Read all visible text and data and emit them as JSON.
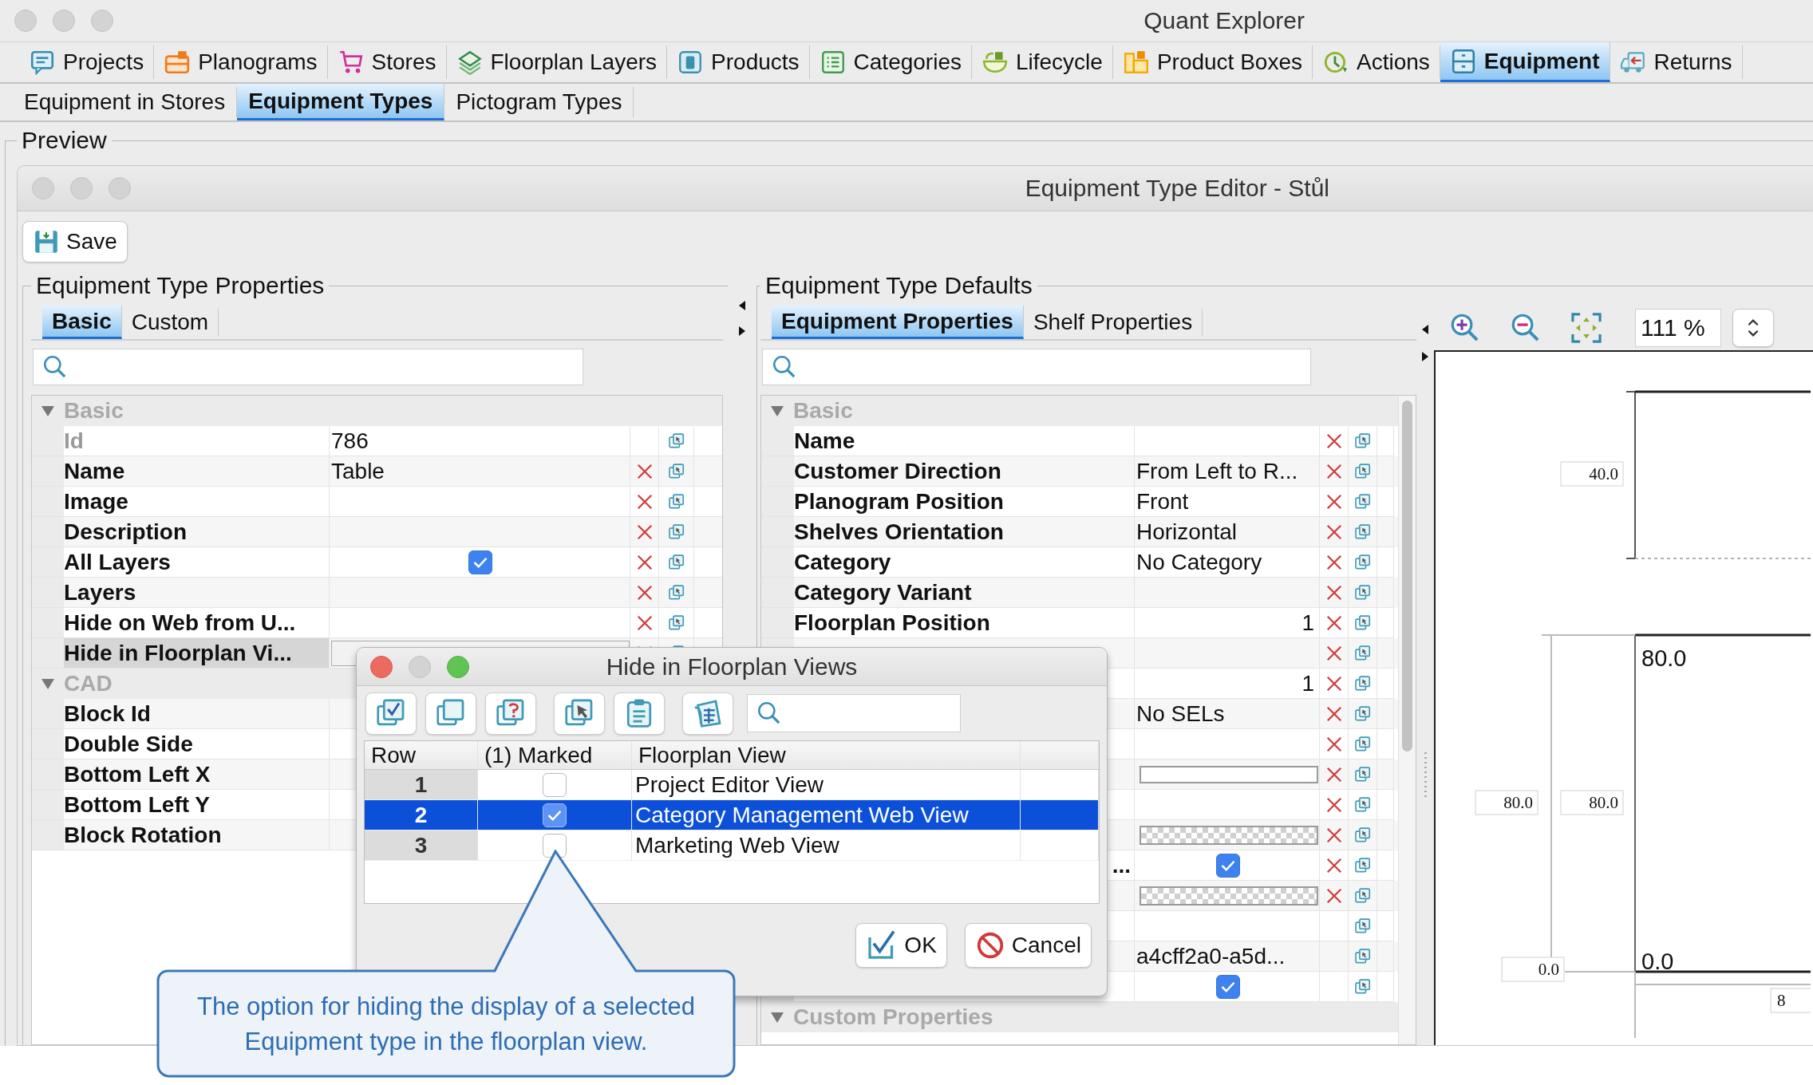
{
  "window": {
    "title": "Quant Explorer"
  },
  "main_tabs": [
    {
      "label": "Projects",
      "selected": false
    },
    {
      "label": "Planograms",
      "selected": false
    },
    {
      "label": "Stores",
      "selected": false
    },
    {
      "label": "Floorplan Layers",
      "selected": false
    },
    {
      "label": "Products",
      "selected": false
    },
    {
      "label": "Categories",
      "selected": false
    },
    {
      "label": "Lifecycle",
      "selected": false
    },
    {
      "label": "Product Boxes",
      "selected": false
    },
    {
      "label": "Actions",
      "selected": false
    },
    {
      "label": "Equipment",
      "selected": true
    },
    {
      "label": "Returns",
      "selected": false
    }
  ],
  "sub_tabs": [
    {
      "label": "Equipment in Stores",
      "selected": false
    },
    {
      "label": "Equipment Types",
      "selected": true
    },
    {
      "label": "Pictogram Types",
      "selected": false
    }
  ],
  "preview": {
    "label": "Preview"
  },
  "editor": {
    "title": "Equipment Type Editor - Stůl",
    "save_button": "Save"
  },
  "properties": {
    "title": "Equipment Type Properties",
    "tabs": [
      {
        "label": "Basic",
        "selected": true
      },
      {
        "label": "Custom",
        "selected": false
      }
    ],
    "rows": [
      {
        "kind": "group",
        "name": "Basic",
        "expanded": true
      },
      {
        "kind": "text",
        "name": "Id",
        "value": "786",
        "disabled": true,
        "selected": false,
        "removable": false,
        "copyable": true
      },
      {
        "kind": "text",
        "name": "Name",
        "value": "Table",
        "disabled": false,
        "selected": false,
        "removable": true,
        "copyable": true
      },
      {
        "kind": "text",
        "name": "Image",
        "disabled": false,
        "selected": false,
        "removable": true,
        "copyable": true
      },
      {
        "kind": "text",
        "name": "Description",
        "disabled": false,
        "selected": false,
        "removable": true,
        "copyable": true
      },
      {
        "kind": "check",
        "name": "All Layers",
        "checked": true,
        "disabled": false,
        "selected": false,
        "removable": true,
        "copyable": true
      },
      {
        "kind": "text",
        "name": "Layers",
        "disabled": false,
        "selected": false,
        "removable": true,
        "copyable": true
      },
      {
        "kind": "text",
        "name": "Hide on Web from U...",
        "disabled": false,
        "selected": false,
        "removable": true,
        "copyable": true
      },
      {
        "kind": "field",
        "name": "Hide in Floorplan Vi...",
        "disabled": false,
        "selected": true,
        "removable": true,
        "copyable": true
      },
      {
        "kind": "group",
        "name": "CAD",
        "expanded": true
      },
      {
        "kind": "text",
        "name": "Block Id",
        "disabled": false,
        "selected": false
      },
      {
        "kind": "text",
        "name": "Double Side",
        "disabled": false,
        "selected": false
      },
      {
        "kind": "text",
        "name": "Bottom Left X",
        "disabled": false,
        "selected": false
      },
      {
        "kind": "text",
        "name": "Bottom Left Y",
        "disabled": false,
        "selected": false
      },
      {
        "kind": "text",
        "name": "Block Rotation",
        "disabled": false,
        "selected": false
      }
    ]
  },
  "defaults": {
    "title": "Equipment Type Defaults",
    "tabs": [
      {
        "label": "Equipment Properties",
        "selected": true
      },
      {
        "label": "Shelf Properties",
        "selected": false
      }
    ],
    "rows": [
      {
        "kind": "group",
        "name": "Basic",
        "expanded": true
      },
      {
        "kind": "text",
        "name": "Name",
        "removable": true,
        "copyable": true
      },
      {
        "kind": "text",
        "name": "Customer Direction",
        "value": "From Left to R...",
        "removable": true,
        "copyable": true
      },
      {
        "kind": "text",
        "name": "Planogram Position",
        "value": "Front",
        "removable": true,
        "copyable": true
      },
      {
        "kind": "text",
        "name": "Shelves Orientation",
        "value": "Horizontal",
        "removable": true,
        "copyable": true
      },
      {
        "kind": "text",
        "name": "Category",
        "value": "No Category",
        "removable": true,
        "copyable": true
      },
      {
        "kind": "text",
        "name": "Category Variant",
        "removable": true,
        "copyable": true
      },
      {
        "kind": "number",
        "name": "Floorplan Position",
        "value": "1",
        "removable": true,
        "copyable": true
      },
      {
        "kind": "text",
        "removable": true,
        "copyable": true
      },
      {
        "kind": "number",
        "value": "1",
        "removable": true,
        "copyable": true
      },
      {
        "kind": "text",
        "value": "No SELs",
        "removable": true,
        "copyable": true
      },
      {
        "kind": "text",
        "removable": true,
        "copyable": true
      },
      {
        "kind": "bar",
        "removable": true,
        "copyable": true
      },
      {
        "kind": "text",
        "removable": true,
        "copyable": true
      },
      {
        "kind": "pattern",
        "removable": true,
        "copyable": true
      },
      {
        "kind": "check",
        "name": "...",
        "name_cut": true,
        "checked": true,
        "removable": true,
        "copyable": true
      },
      {
        "kind": "pattern",
        "removable": true,
        "copyable": true
      },
      {
        "kind": "text",
        "removable": false,
        "copyable": true
      },
      {
        "kind": "text",
        "value": "a4cff2a0-a5d...",
        "removable": false,
        "copyable": true
      },
      {
        "kind": "check",
        "checked": true,
        "removable": false,
        "copyable": true
      },
      {
        "kind": "group",
        "name": "Custom Properties",
        "expanded": true
      }
    ]
  },
  "preview_canvas": {
    "zoom": "111 %",
    "dimension_labels": [
      "40.0",
      "80.0",
      "80.0",
      "0.0",
      "8"
    ],
    "corner_labels": [
      "80.0",
      "0.0"
    ]
  },
  "dialog": {
    "title": "Hide in Floorplan Views",
    "columns": [
      "Row",
      "(1) Marked",
      "Floorplan View"
    ],
    "rows": [
      {
        "row": "1",
        "marked": false,
        "view": "Project Editor View",
        "selected": false
      },
      {
        "row": "2",
        "marked": true,
        "view": "Category Management Web View",
        "selected": true
      },
      {
        "row": "3",
        "marked": false,
        "view": "Marketing Web View",
        "selected": false
      }
    ],
    "buttons": [
      "OK",
      "Cancel"
    ]
  },
  "callout": {
    "text": "The option for hiding the display of a selected Equipment type in the floorplan view."
  }
}
